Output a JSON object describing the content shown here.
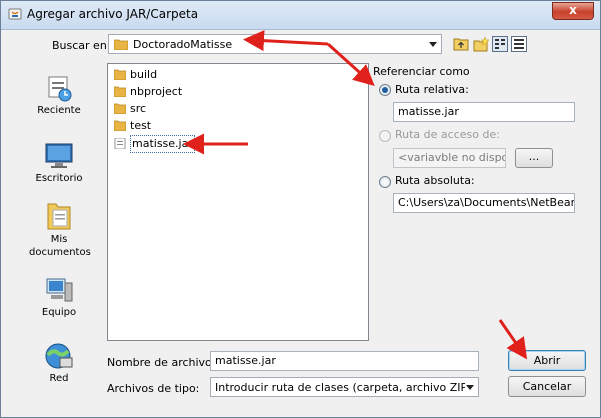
{
  "window": {
    "title": "Agregar archivo JAR/Carpeta",
    "close_label": "x"
  },
  "lookin": {
    "label": "Buscar en:",
    "value": "DoctoradoMatisse"
  },
  "toolbar": {
    "icons": [
      "up-folder-icon",
      "new-folder-icon",
      "list-view-icon",
      "details-view-icon"
    ]
  },
  "places": [
    {
      "label": "Reciente",
      "icon": "recent-icon"
    },
    {
      "label": "Escritorio",
      "icon": "desktop-icon"
    },
    {
      "label": "Mis documentos",
      "icon": "documents-icon"
    },
    {
      "label": "Equipo",
      "icon": "computer-icon"
    },
    {
      "label": "Red",
      "icon": "network-icon"
    }
  ],
  "files": [
    {
      "name": "build",
      "type": "folder"
    },
    {
      "name": "nbproject",
      "type": "folder"
    },
    {
      "name": "src",
      "type": "folder"
    },
    {
      "name": "test",
      "type": "folder"
    },
    {
      "name": "matisse.jar",
      "type": "file",
      "selected": true
    }
  ],
  "reference": {
    "title": "Referenciar como",
    "relative_label": "Ruta relativa:",
    "relative_value": "matisse.jar",
    "access_label": "Ruta de acceso de:",
    "access_value": "<variavble no disponible",
    "browse_label": "...",
    "absolute_label": "Ruta absoluta:",
    "absolute_value": "C:\\Users\\za\\Documents\\NetBeansProje"
  },
  "filename": {
    "label": "Nombre de archivo:",
    "value": "matisse.jar"
  },
  "filetype": {
    "label": "Archivos de tipo:",
    "value": "Introducir ruta de clases (carpeta, archivo ZIP o J..."
  },
  "buttons": {
    "open": "Abrir",
    "cancel": "Cancelar"
  },
  "colors": {
    "annotation_arrow": "#e0201b",
    "title_gradient": "#c9daef",
    "close_button": "#c7412b"
  }
}
